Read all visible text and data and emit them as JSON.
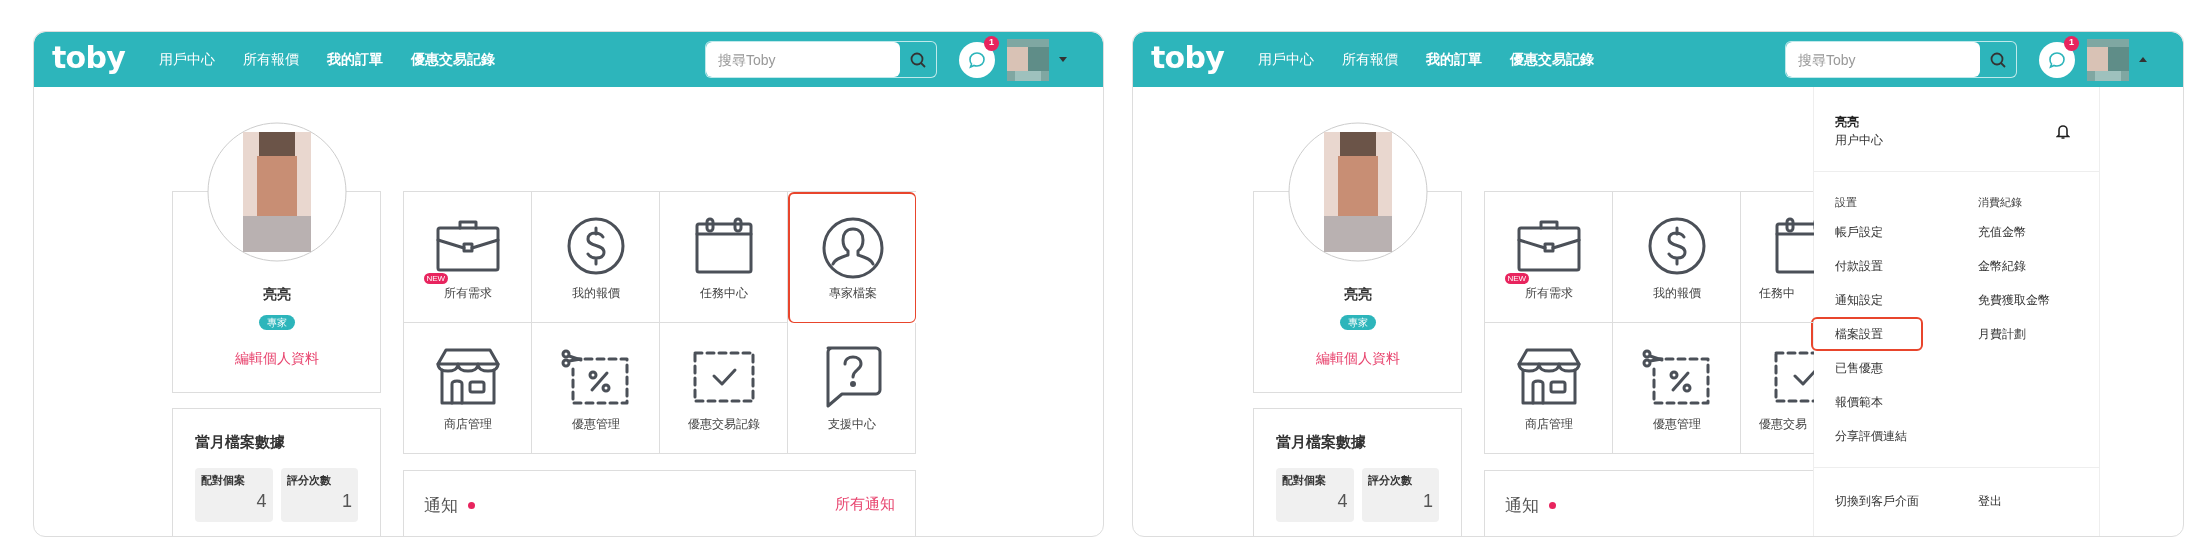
{
  "windows": [
    {
      "header": {
        "logo": "toby",
        "nav": [
          "用戶中心",
          "所有報價",
          "我的訂單",
          "優惠交易記錄"
        ],
        "search": {
          "placeholder": "搜尋Toby"
        },
        "chat_badge": "1",
        "menu_open": false
      },
      "profile": {
        "name": "亮亮",
        "badge": "專家",
        "edit_link": "編輯個人資料"
      },
      "stats": {
        "title": "當月檔案數據",
        "items": [
          {
            "label": "配對個案",
            "value": "4"
          },
          {
            "label": "評分次數",
            "value": "1"
          }
        ]
      },
      "tile_rows": [
        [
          {
            "kind": "briefcase",
            "label": "所有需求",
            "new_badge": "NEW",
            "highlighted": false,
            "cut": false
          },
          {
            "kind": "dollar",
            "label": "我的報價",
            "highlighted": false,
            "cut": false
          },
          {
            "kind": "calendar",
            "label": "任務中心",
            "highlighted": false,
            "cut": false
          },
          {
            "kind": "person",
            "label": "專家檔案",
            "highlighted": true,
            "cut": false
          }
        ],
        [
          {
            "kind": "shop",
            "label": "商店管理",
            "highlighted": false,
            "cut": false
          },
          {
            "kind": "coupon",
            "label": "優惠管理",
            "highlighted": false,
            "cut": false
          },
          {
            "kind": "check",
            "label": "優惠交易記錄",
            "highlighted": false,
            "cut": false
          },
          {
            "kind": "help",
            "label": "支援中心",
            "highlighted": false,
            "cut": false
          }
        ]
      ],
      "notifications": {
        "title": "通知",
        "unread": true,
        "link": "所有通知"
      }
    },
    {
      "header": {
        "logo": "toby",
        "nav": [
          "用戶中心",
          "所有報價",
          "我的訂單",
          "優惠交易記錄"
        ],
        "search": {
          "placeholder": "搜尋Toby"
        },
        "chat_badge": "1",
        "menu_open": true
      },
      "profile": {
        "name": "亮亮",
        "badge": "專家",
        "edit_link": "編輯個人資料"
      },
      "stats": {
        "title": "當月檔案數據",
        "items": [
          {
            "label": "配對個案",
            "value": "4"
          },
          {
            "label": "評分次數",
            "value": "1"
          }
        ]
      },
      "tile_rows": [
        [
          {
            "kind": "briefcase",
            "label": "所有需求",
            "new_badge": "NEW",
            "highlighted": false,
            "cut": false
          },
          {
            "kind": "dollar",
            "label": "我的報價",
            "highlighted": false,
            "cut": false
          },
          {
            "kind": "calendar",
            "label": "任務中",
            "highlighted": false,
            "cut": true
          }
        ],
        [
          {
            "kind": "shop",
            "label": "商店管理",
            "highlighted": false,
            "cut": false
          },
          {
            "kind": "coupon",
            "label": "優惠管理",
            "highlighted": false,
            "cut": false
          },
          {
            "kind": "check",
            "label": "優惠交易",
            "highlighted": false,
            "cut": true
          }
        ]
      ],
      "notifications": {
        "title": "通知",
        "unread": true
      },
      "menu": {
        "name": "亮亮",
        "subtitle": "用户中心",
        "columns": [
          {
            "heading": "設置",
            "items": [
              {
                "label": "帳戶設定",
                "highlighted": false
              },
              {
                "label": "付款設置",
                "highlighted": false
              },
              {
                "label": "通知設定",
                "highlighted": false
              },
              {
                "label": "檔案設置",
                "highlighted": true
              },
              {
                "label": "已售優惠",
                "highlighted": false
              },
              {
                "label": "報價範本",
                "highlighted": false
              },
              {
                "label": "分享評價連結",
                "highlighted": false
              }
            ]
          },
          {
            "heading": "消費紀錄",
            "items": [
              {
                "label": "充值金幣",
                "highlighted": false
              },
              {
                "label": "金幣紀錄",
                "highlighted": false
              },
              {
                "label": "免費獲取金幣",
                "highlighted": false
              },
              {
                "label": "月費計劃",
                "highlighted": false
              }
            ]
          }
        ],
        "footer": [
          "切換到客戶介面",
          "登出"
        ]
      }
    }
  ]
}
